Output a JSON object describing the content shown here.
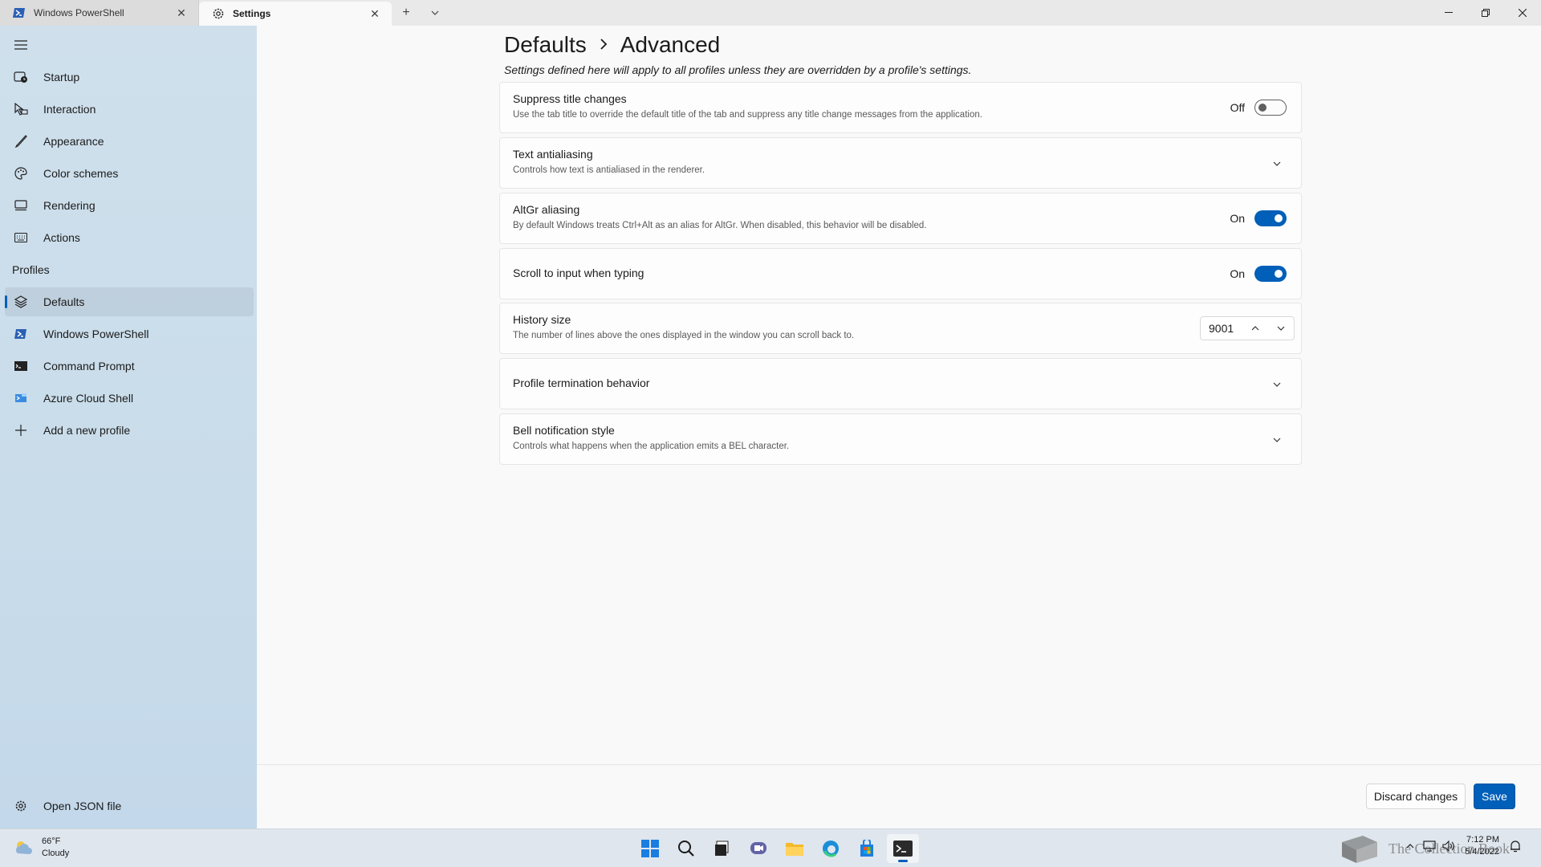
{
  "titlebar": {
    "tabs": [
      {
        "label": "Windows PowerShell",
        "icon": "powershell-icon"
      },
      {
        "label": "Settings",
        "icon": "gear-icon"
      }
    ]
  },
  "sidebar": {
    "items": [
      {
        "label": "Startup",
        "icon": "startup-icon"
      },
      {
        "label": "Interaction",
        "icon": "interaction-icon"
      },
      {
        "label": "Appearance",
        "icon": "brush-icon"
      },
      {
        "label": "Color schemes",
        "icon": "palette-icon"
      },
      {
        "label": "Rendering",
        "icon": "monitor-icon"
      },
      {
        "label": "Actions",
        "icon": "keyboard-icon"
      }
    ],
    "profiles_header": "Profiles",
    "profiles": [
      {
        "label": "Defaults",
        "icon": "layers-icon"
      },
      {
        "label": "Windows PowerShell",
        "icon": "powershell-icon"
      },
      {
        "label": "Command Prompt",
        "icon": "cmd-icon"
      },
      {
        "label": "Azure Cloud Shell",
        "icon": "azure-icon"
      },
      {
        "label": "Add a new profile",
        "icon": "plus-icon"
      }
    ],
    "open_json": "Open JSON file"
  },
  "main": {
    "breadcrumb_parent": "Defaults",
    "breadcrumb_current": "Advanced",
    "subtitle": "Settings defined here will apply to all profiles unless they are overridden by a profile's settings.",
    "settings": {
      "suppress_title": {
        "title": "Suppress title changes",
        "desc": "Use the tab title to override the default title of the tab and suppress any title change messages from the application.",
        "state": "Off"
      },
      "antialiasing": {
        "title": "Text antialiasing",
        "desc": "Controls how text is antialiased in the renderer."
      },
      "altgr": {
        "title": "AltGr aliasing",
        "desc": "By default Windows treats Ctrl+Alt as an alias for AltGr. When disabled, this behavior will be disabled.",
        "state": "On"
      },
      "scroll_input": {
        "title": "Scroll to input when typing",
        "state": "On"
      },
      "history": {
        "title": "History size",
        "desc": "The number of lines above the ones displayed in the window you can scroll back to.",
        "value": "9001"
      },
      "termination": {
        "title": "Profile termination behavior"
      },
      "bell": {
        "title": "Bell notification style",
        "desc": "Controls what happens when the application emits a BEL character."
      }
    },
    "discard_label": "Discard changes",
    "save_label": "Save"
  },
  "taskbar": {
    "temperature": "66°F",
    "condition": "Cloudy",
    "time": "7:12 PM",
    "date": "5/4/2022",
    "watermark": "The Collection Book"
  },
  "colors": {
    "accent": "#005fb8",
    "sidebar_bg": "#cfe0ec",
    "page_bg": "#f9f9f9"
  }
}
